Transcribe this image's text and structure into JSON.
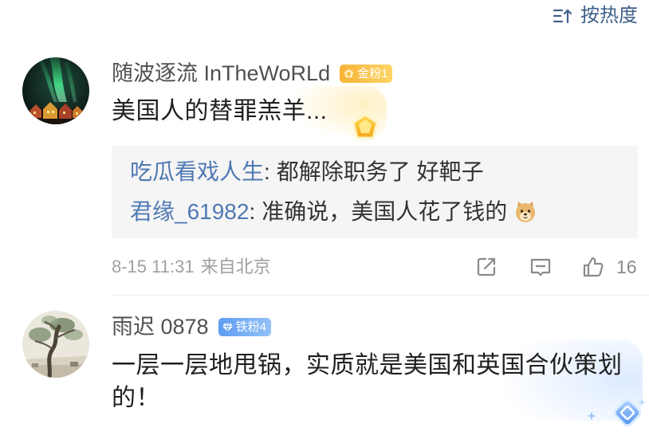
{
  "sort": {
    "icon": "sort-icon",
    "label": "按热度"
  },
  "comments": [
    {
      "avatar": "aurora-night-avatar",
      "username": "随波逐流 InTheWoRLd",
      "badge": {
        "icon": "gold-fan-crown-icon",
        "label": "金粉1"
      },
      "text": "美国人的替罪羔羊...",
      "bubble_decoration": "gold-gem-icon",
      "replies": [
        {
          "user": "吃瓜看戏人生",
          "separator": ":",
          "text": "都解除职务了 好靶子"
        },
        {
          "user": "君缘_61982",
          "separator": ":",
          "text": "准确说，美国人花了钱的",
          "emoji": "doge-emoji-icon"
        }
      ],
      "time": "8-15 11:31",
      "source": "来自北京",
      "actions": {
        "share_icon": "share-icon",
        "comment_icon": "comment-icon",
        "like_icon": "like-icon",
        "like_count": "16"
      }
    },
    {
      "avatar": "landscape-painting-avatar",
      "username": "雨迟 0878",
      "badge": {
        "icon": "iron-fan-diamond-icon",
        "label": "铁粉4"
      },
      "text": "一层一层地甩锅，实质就是美国和英国合伙策划的！",
      "bubble_decoration": "blue-diamond-icon"
    }
  ],
  "colors": {
    "text": "#1f1f1f",
    "username": "#505050",
    "link": "#4f79b4",
    "meta": "#a0a0a0",
    "sort": "#40608a",
    "reply_bg": "#f5f5f5",
    "gold_badge": "#f7b438",
    "iron_badge": "#5f9cf1"
  }
}
